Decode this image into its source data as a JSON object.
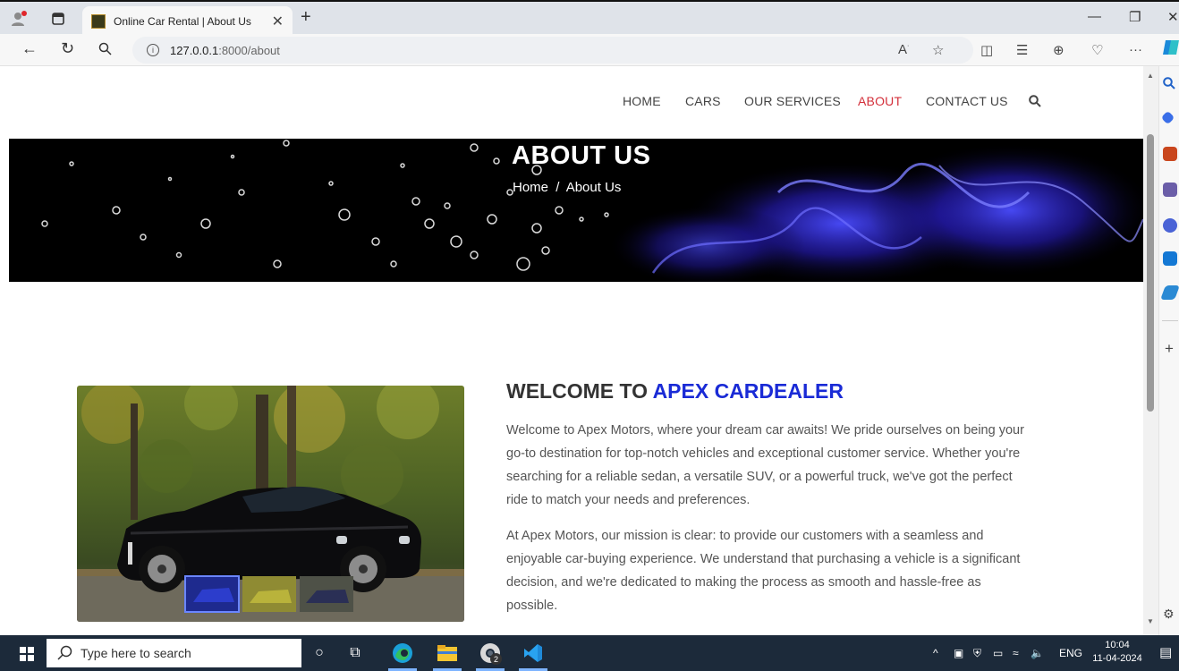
{
  "browser": {
    "tab_title": "Online Car Rental | About Us",
    "url_host": "127.0.0.1",
    "url_rest": ":8000/about"
  },
  "nav": {
    "home": "HOME",
    "cars": "CARS",
    "services": "OUR SERVICES",
    "about": "ABOUT",
    "contact": "CONTACT US",
    "active_color": "#d32f3a"
  },
  "banner": {
    "title": "ABOUT US",
    "crumb_home": "Home",
    "crumb_sep": "/",
    "crumb_current": "About Us"
  },
  "welcome": {
    "prefix": "WELCOME TO ",
    "brand": "APEX CARDEALER",
    "brand_color": "#1a2bd6"
  },
  "paragraphs": {
    "p1": "Welcome to Apex Motors, where your dream car awaits! We pride ourselves on being your go-to destination for top-notch vehicles and exceptional customer service. Whether you're searching for a reliable sedan, a versatile SUV, or a powerful truck, we've got the perfect ride to match your needs and preferences.",
    "p2": "At Apex Motors, our mission is clear: to provide our customers with a seamless and enjoyable car-buying experience. We understand that purchasing a vehicle is a significant decision, and we're dedicated to making the process as smooth and hassle-free as possible."
  },
  "taskbar": {
    "search_placeholder": "Type here to search",
    "lang": "ENG",
    "time": "10:04",
    "date": "11-04-2024",
    "chrome_badge": "2"
  }
}
